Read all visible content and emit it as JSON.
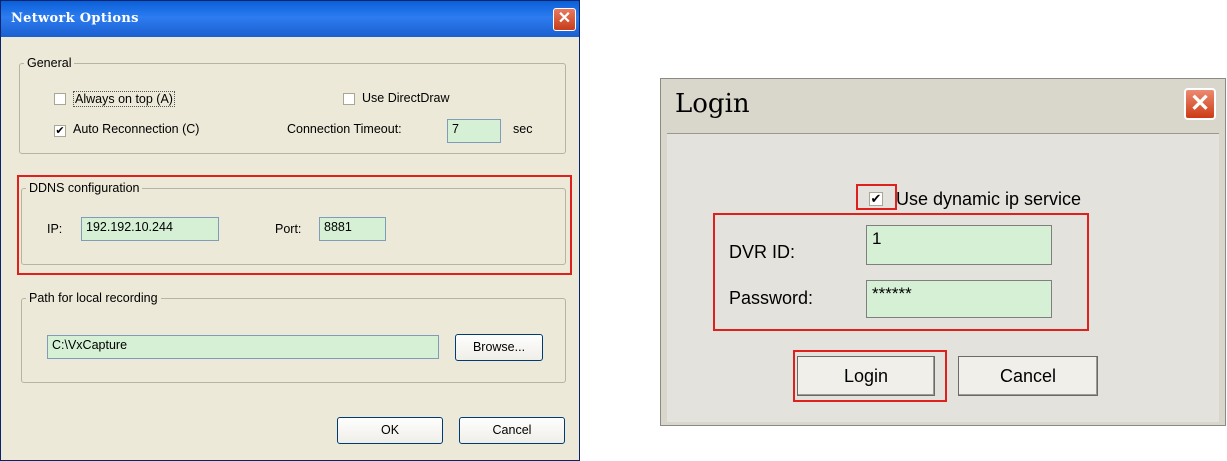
{
  "network_options": {
    "title": "Network Options",
    "close_glyph": "✕",
    "general": {
      "legend": "General",
      "always_on_top": {
        "label": "Always on top (A)",
        "checked": false
      },
      "use_directdraw": {
        "label": "Use DirectDraw",
        "checked": false
      },
      "auto_reconnection": {
        "label": "Auto Reconnection (C)",
        "checked": true
      },
      "timeout_label": "Connection Timeout:",
      "timeout_value": "7",
      "timeout_unit": "sec"
    },
    "ddns": {
      "legend": "DDNS configuration",
      "ip_label": "IP:",
      "ip_value": "192.192.10.244",
      "port_label": "Port:",
      "port_value": "8881"
    },
    "recording": {
      "legend": "Path for local recording",
      "path_value": "C:\\VxCapture",
      "browse_label": "Browse..."
    },
    "ok_label": "OK",
    "cancel_label": "Cancel",
    "check_glyph": "✔"
  },
  "login": {
    "title": "Login",
    "close_glyph": "✕",
    "use_dynamic_ip": {
      "label": "Use dynamic ip service",
      "checked": true
    },
    "dvr_id_label": "DVR ID:",
    "dvr_id_value": "1",
    "password_label": "Password:",
    "password_value": "******",
    "login_label": "Login",
    "cancel_label": "Cancel",
    "check_glyph": "✔"
  },
  "colors": {
    "highlight": "#e0201c",
    "field_bg": "#d5f0d5",
    "xp_titlebar": "#0a5fd8"
  }
}
